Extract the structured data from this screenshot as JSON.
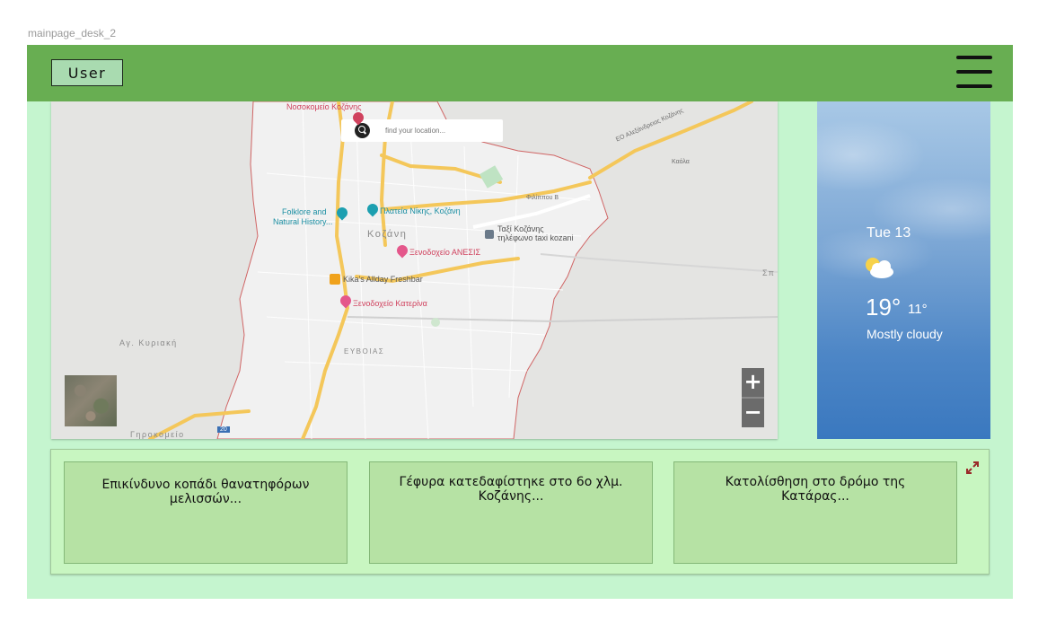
{
  "frame_label": "mainpage_desk_2",
  "header": {
    "user_button": "User",
    "menu_icon": "hamburger-menu-icon"
  },
  "map": {
    "search_placeholder": "find your location...",
    "labels": {
      "hospital": "Νοσοκομείο Κοζάνης",
      "road_egnatia": "ΕΟ Αλεξάνδρειας Κοζάνης",
      "road_kaola": "Καόλα",
      "road_filippou": "Φιλίππου Β",
      "folklore_line1": "Folklore and",
      "folklore_line2": "Natural History...",
      "plateia": "Πλατεία Νίκης, Κοζάνη",
      "taxi_line1": "Ταξί Κοζάνης",
      "taxi_line2": "τηλέφωνο taxi kozani",
      "kozani": "Κοζάνη",
      "anesis": "Ξενοδοχείο ΑΝΕΣΙΣ",
      "kikas": "Kika's Allday Freshbar",
      "katerina": "Ξενοδοχείο Κατερίνα",
      "ag_kyriaki": "Αγ. Κυριακή",
      "evoias": "ΕΥΒΟΙΑΣ",
      "girokomeio": "Γηροκομείο",
      "road_20": "20",
      "road_sp": "Σπ"
    },
    "zoom_in": "+",
    "zoom_out": "−"
  },
  "weather": {
    "day": "Tue 13",
    "icon": "partly-cloudy-icon",
    "temp_high": "19°",
    "temp_low": "11°",
    "condition": "Mostly cloudy"
  },
  "news": {
    "cards": [
      {
        "title": "Επικίνδυνο κοπάδι θανατηφόρων μελισσών..."
      },
      {
        "title": "Γέφυρα κατεδαφίστηκε στο 6ο χλμ. Κοζάνης..."
      },
      {
        "title": "Κατολίσθηση στο δρόμο της Κατάρας..."
      }
    ],
    "expand_icon": "expand-arrows-icon"
  },
  "colors": {
    "header_bg": "#68ae52",
    "app_bg": "#c5f5cf",
    "news_card_bg": "#b6e2a4",
    "weather_bg": "#4d86c6"
  }
}
